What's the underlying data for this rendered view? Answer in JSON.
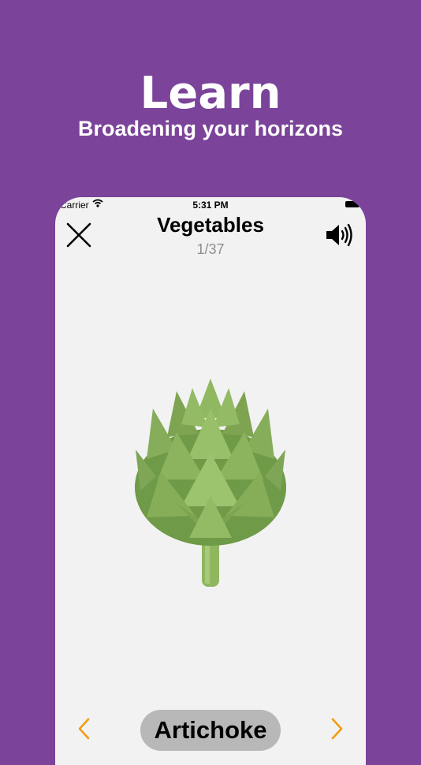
{
  "hero": {
    "title": "Learn",
    "subtitle": "Broadening your horizons"
  },
  "status_bar": {
    "carrier": "Carrier",
    "time": "5:31 PM"
  },
  "header": {
    "title": "Vegetables",
    "counter": "1/37",
    "close_icon": "close-icon",
    "sound_icon": "speaker-icon"
  },
  "card": {
    "image_subject": "artichoke",
    "word": "Artichoke"
  },
  "navigation": {
    "prev_icon": "chevron-left-icon",
    "next_icon": "chevron-right-icon"
  },
  "colors": {
    "background": "#7b4399",
    "card": "#f2f2f2",
    "pill": "#b8b8b8",
    "accent": "#f39c12",
    "counter": "#8e8e8e"
  }
}
